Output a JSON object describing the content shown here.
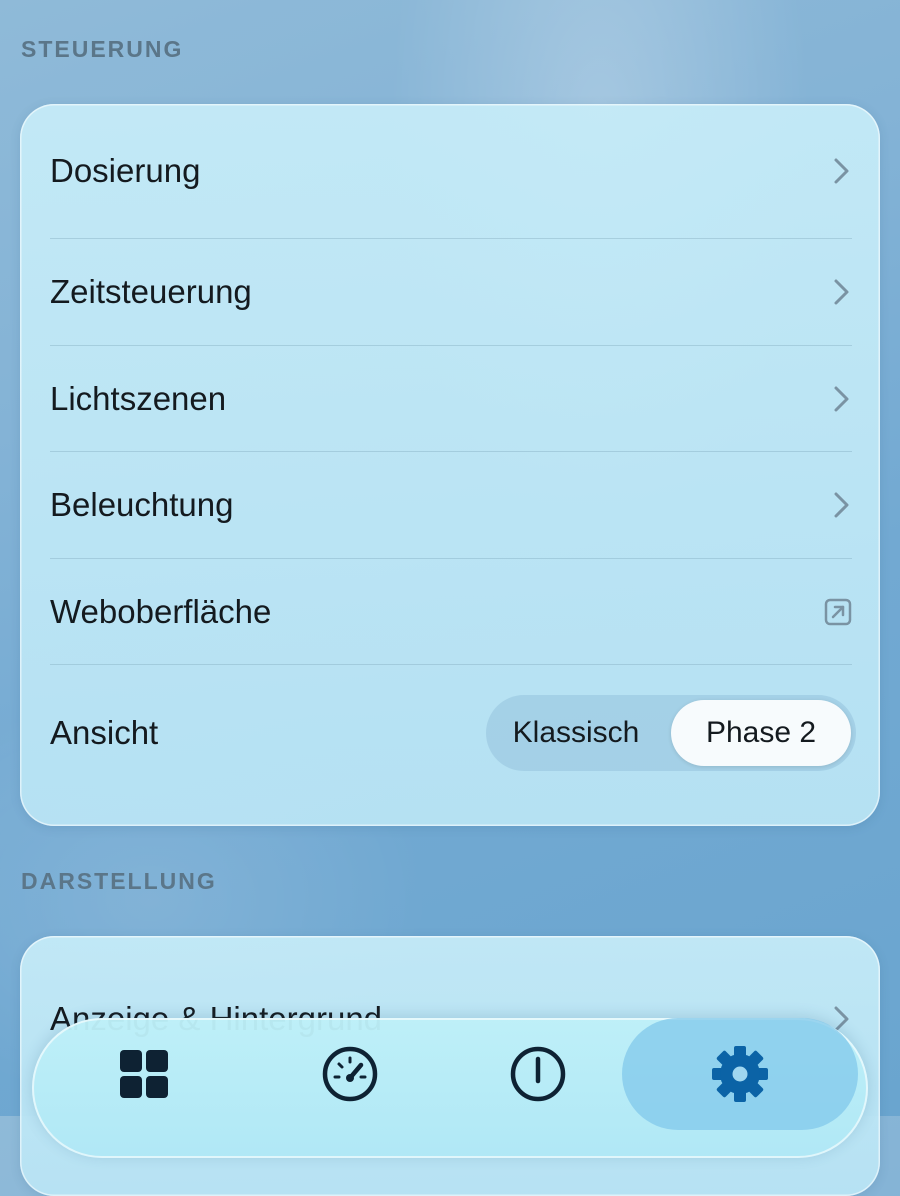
{
  "sections": {
    "steuerung": {
      "title": "STEUERUNG",
      "rows": {
        "dosierung": "Dosierung",
        "zeitsteuerung": "Zeitsteuerung",
        "lichtszenen": "Lichtszenen",
        "beleuchtung": "Beleuchtung",
        "weboberflaeche": "Weboberfläche",
        "ansicht": "Ansicht"
      },
      "view_toggle": {
        "options": [
          "Klassisch",
          "Phase 2"
        ],
        "selected": "Phase 2"
      }
    },
    "darstellung": {
      "title": "DARSTELLUNG",
      "rows": {
        "anzeige": "Anzeige & Hintergrund"
      }
    }
  },
  "tabbar": {
    "tabs": [
      {
        "icon": "grid-icon"
      },
      {
        "icon": "gauge-icon"
      },
      {
        "icon": "power-icon"
      },
      {
        "icon": "gear-icon",
        "active": true
      }
    ]
  },
  "colors": {
    "accent": "#0b63a6",
    "text": "#141a1f",
    "section_header": "#5b7689",
    "tab_icon": "#0e2233"
  }
}
